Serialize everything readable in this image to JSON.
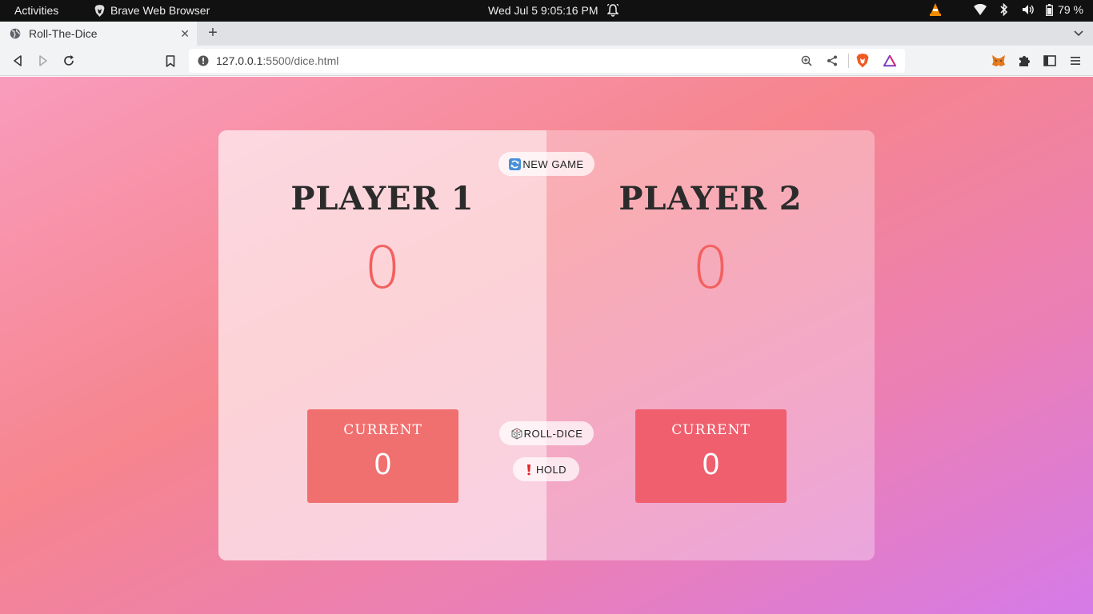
{
  "os": {
    "activities": "Activities",
    "app_name": "Brave Web Browser",
    "clock": "Wed Jul 5  9:05:16 PM",
    "battery": "79 %"
  },
  "browser": {
    "tab_title": "Roll-The-Dice",
    "url_host": "127.0.0.1",
    "url_rest": ":5500/dice.html"
  },
  "game": {
    "new_game_label": "NEW GAME",
    "roll_label": "ROLL-DICE",
    "hold_label": "HOLD",
    "players": [
      {
        "name": "PLAYER 1",
        "score": "0",
        "current_label": "CURRENT",
        "current": "0"
      },
      {
        "name": "PLAYER 2",
        "score": "0",
        "current_label": "CURRENT",
        "current": "0"
      }
    ]
  },
  "colors": {
    "score": "#f2605f",
    "current_bg_p1": "#f06f6f",
    "current_bg_p2": "#ef5f6e"
  }
}
